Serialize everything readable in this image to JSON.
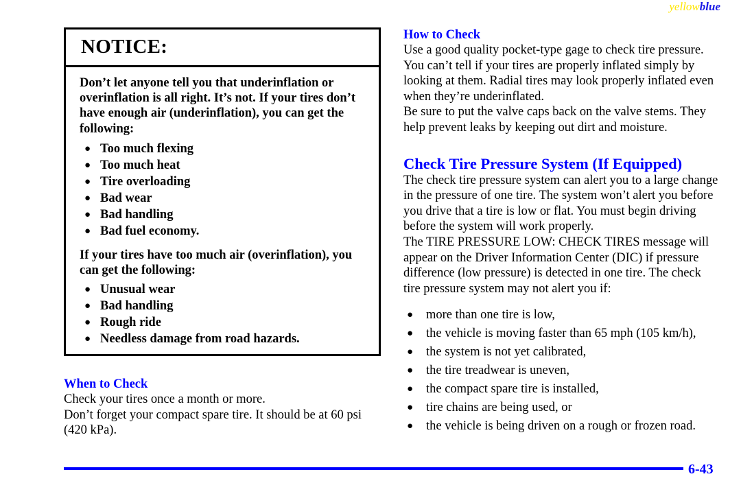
{
  "header": {
    "part_yellow": "yellow",
    "part_blue": "blue"
  },
  "notice_box": {
    "heading": "NOTICE:",
    "paragraph_1": "Don’t let anyone tell you that underinflation or overinflation is all right. It’s not. If your tires don’t have enough air (underinflation), you can get the following:",
    "list_1": [
      "Too much flexing",
      "Too much heat",
      "Tire overloading",
      "Bad wear",
      "Bad handling",
      "Bad fuel economy."
    ],
    "paragraph_2": "If your tires have too much air (overinflation), you can get the following:",
    "list_2": [
      "Unusual wear",
      "Bad handling",
      "Rough ride",
      "Needless damage from road hazards."
    ],
    "bullet_glyph": "●"
  },
  "when_to_check": {
    "heading": "When to Check",
    "paragraph_1": "Check your tires once a month or more.",
    "paragraph_2": "Don’t forget your compact spare tire. It should be at 60 psi (420 kPa)."
  },
  "how_to_check": {
    "heading": "How to Check",
    "paragraph_1": "Use a good quality pocket‐type gage to check tire pressure. You can’t tell if your tires are properly inflated simply by looking at them. Radial tires may look properly inflated even when they’re underinflated.",
    "paragraph_2": "Be sure to put the valve caps back on the valve stems. They help prevent leaks by keeping out dirt and moisture."
  },
  "check_tire_pressure_system": {
    "heading": "Check Tire Pressure System (If Equipped)",
    "paragraph_1": "The check tire pressure system can alert you to a large change in the pressure of one tire. The system won’t alert you before you drive that a tire is low or flat. You must begin driving before the system will work properly.",
    "paragraph_2": "The TIRE PRESSURE LOW: CHECK TIRES message will appear on the Driver Information Center (DIC) if pressure difference (low pressure) is detected in one tire. The check tire pressure system may not alert you if:",
    "list": [
      "more than one tire is low,",
      "the vehicle is moving faster than 65 mph (105 km/h),",
      "the system is not yet calibrated,",
      "the tire treadwear is uneven,",
      "the compact spare tire is installed,",
      "tire chains are being used, or",
      "the vehicle is being driven on a rough or frozen road."
    ],
    "bullet_glyph": "●"
  },
  "footer": {
    "page_number": "6-43"
  },
  "colors": {
    "heading_blue": "#0000ff",
    "rule_blue": "#0000ff",
    "header_yellow": "#ffe600",
    "header_blue": "#1a1ae6",
    "box_border": "#000000"
  }
}
